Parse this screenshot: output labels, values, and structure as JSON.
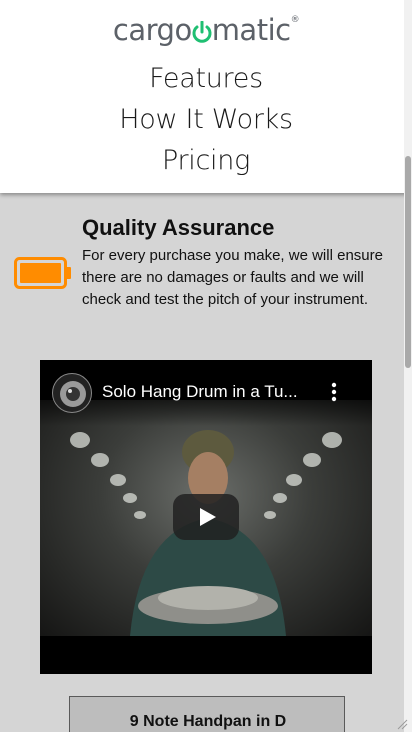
{
  "header": {
    "logo_prefix": "cargo",
    "logo_power": "o",
    "logo_suffix": "matic",
    "logo_mark": "®",
    "nav": [
      {
        "label": "Features"
      },
      {
        "label": "How It Works"
      },
      {
        "label": "Pricing"
      }
    ]
  },
  "feature": {
    "title": "Quality Assurance",
    "text": "For every purchase you make, we will ensure there are no damages or faults and we will check and test the pitch of your instrument.",
    "icon": "battery-icon",
    "icon_color": "#ff8c00"
  },
  "video": {
    "title": "Solo Hang Drum in a Tu...",
    "channel_icon": "channel-avatar",
    "menu_icon": "kebab-menu-icon",
    "play_icon": "play-icon"
  },
  "product": {
    "title": "9 Note Handpan in D"
  },
  "colors": {
    "brand_text": "#5c6168",
    "brand_accent": "#1fbf72",
    "background": "#d5d5d5"
  }
}
